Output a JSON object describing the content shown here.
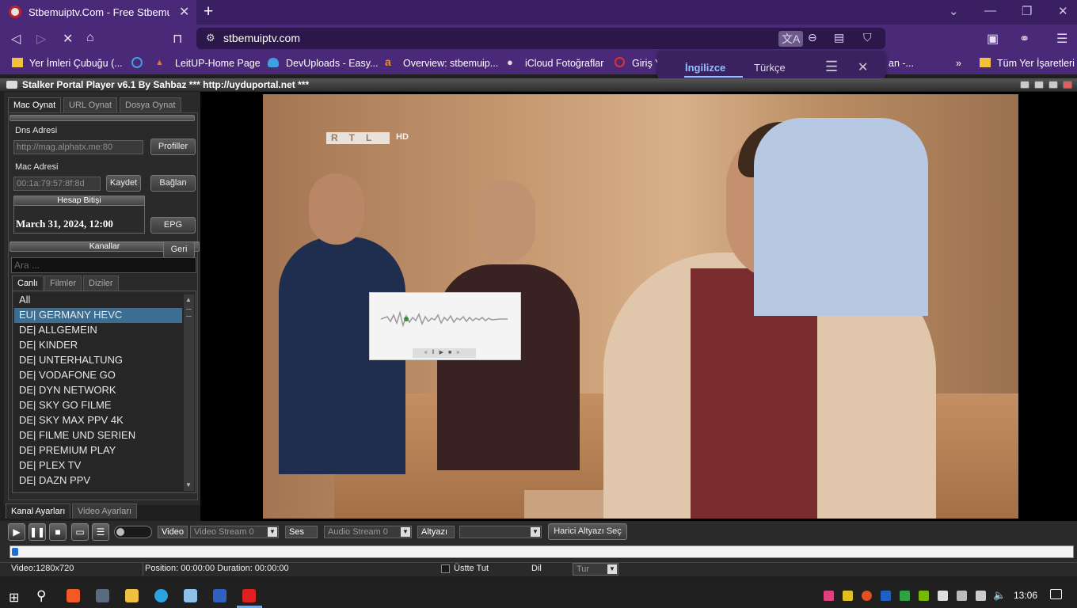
{
  "browser": {
    "tab_title": "Stbemuiptv.Com - Free Stbemu C",
    "url": "stbemuiptv.com",
    "bookmarks": [
      "Yer İmleri Çubuğu (...",
      "LeitUP-Home Page",
      "DevUploads - Easy...",
      "Overview: stbemuip...",
      "iCloud Fotoğraflar",
      "Giriş Y",
      "an -...",
      "Tüm Yer İşaretleri"
    ],
    "translate": {
      "from": "İngilizce",
      "to": "Türkçe"
    }
  },
  "app": {
    "title": "Stalker Portal Player v6.1 By Sahbaz  *** http://uyduportal.net ***",
    "tabs": [
      "Mac Oynat",
      "URL Oynat",
      "Dosya Oynat"
    ],
    "dns_label": "Dns Adresi",
    "dns_value": "http://mag.alphatx.me:80",
    "profiles_button": "Profiller",
    "mac_label": "Mac Adresi",
    "mac_value": "00:1a:79:57:8f:8d",
    "save_button": "Kaydet",
    "connect_button": "Bağlan",
    "expiry_header": "Hesap Bitişi",
    "expiry_value": "March 31, 2024, 12:00",
    "epg_button": "EPG",
    "channels_header": "Kanallar",
    "back_button": "Geri",
    "search_placeholder": "Ara ...",
    "content_tabs": [
      "Canlı",
      "Filmler",
      "Diziler"
    ],
    "channels": [
      "All",
      "EU| GERMANY HEVC",
      "DE| ALLGEMEIN",
      "DE| KINDER",
      "DE| UNTERHALTUNG",
      "DE| VODAFONE GO",
      "DE| DYN NETWORK",
      "DE| SKY GO FILME",
      "DE| SKY MAX PPV 4K",
      "DE| FILME UND SERIEN",
      "DE| PREMIUM PLAY",
      "DE| PLEX TV",
      "DE| DAZN PPV"
    ],
    "selected_channel": 1,
    "bottom_tabs": [
      "Kanal Ayarları",
      "Video Ayarları"
    ],
    "video_logo": "RTL",
    "video_logo_suffix": "HD",
    "controls": {
      "video_label": "Video",
      "video_stream": "Video Stream 0",
      "audio_label": "Ses",
      "audio_stream": "Audio Stream 0",
      "subtitle_label": "Altyazı",
      "subtitle_value": "",
      "external_subtitle_button": "Harici Altyazı Seç"
    },
    "status": {
      "resolution": "Video:1280x720",
      "position": "Position: 00:00:00 Duration: 00:00:00",
      "always_on_top": "Üstte Tut",
      "language_label": "Dil",
      "language_value": "Tur"
    }
  },
  "taskbar": {
    "clock": "13:06"
  }
}
